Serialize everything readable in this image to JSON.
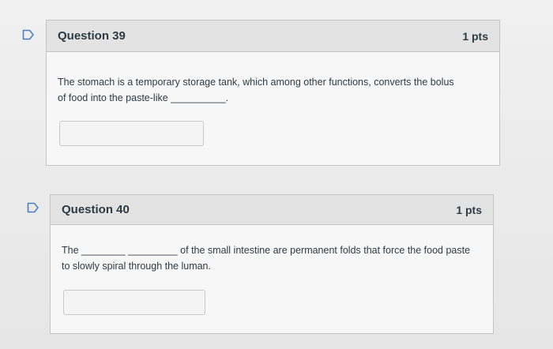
{
  "questions": [
    {
      "title": "Question 39",
      "points": "1 pts",
      "text_lines": [
        "The stomach is a temporary storage tank, which among other functions, converts the bolus",
        "of food into the paste-like __________."
      ],
      "answer_value": ""
    },
    {
      "title": "Question 40",
      "points": "1 pts",
      "text_line1_prefix": "The",
      "text_line1_blank": "________ _________",
      "text_line1_suffix": "of the small intestine are permanent folds that force the food paste",
      "text_line2": "to slowly spiral through the luman.",
      "answer_value": ""
    }
  ],
  "icons": {
    "flag": "flag-question-icon"
  },
  "colors": {
    "flag_stroke": "#4a7fc1",
    "header_bg": "#e3e3e3",
    "border": "#c4c4c4",
    "text": "#2d3b45"
  }
}
